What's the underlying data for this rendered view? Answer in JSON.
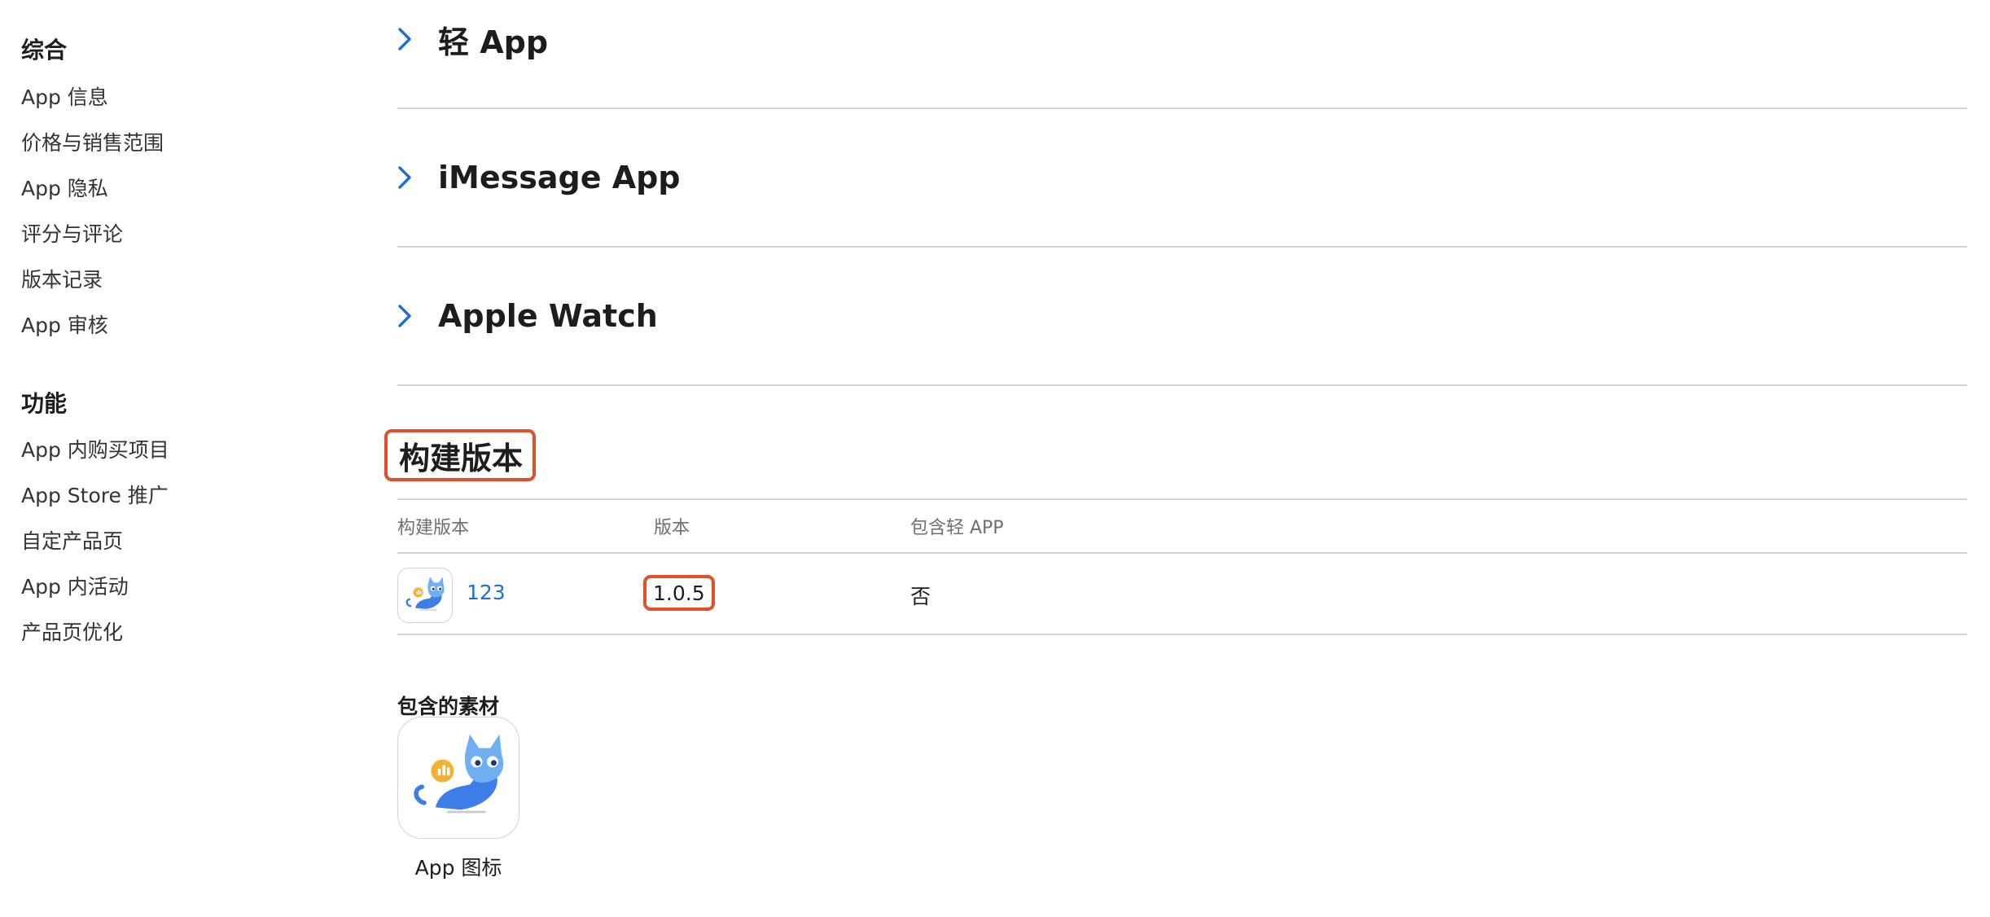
{
  "sidebar": {
    "general": {
      "title": "综合",
      "items": [
        "App 信息",
        "价格与销售范围",
        "App 隐私",
        "评分与评论",
        "版本记录",
        "App 审核"
      ]
    },
    "features": {
      "title": "功能",
      "items": [
        "App 内购买项目",
        "App Store 推广",
        "自定产品页",
        "App 内活动",
        "产品页优化"
      ]
    }
  },
  "main": {
    "sections": [
      {
        "label": "轻 App",
        "icon": "chevron-right-icon"
      },
      {
        "label": "iMessage App",
        "icon": "chevron-right-icon"
      },
      {
        "label": "Apple Watch",
        "icon": "chevron-right-icon"
      }
    ],
    "builds": {
      "heading": "构建版本",
      "columns": [
        "构建版本",
        "版本",
        "包含轻 APP"
      ],
      "row": {
        "icon": "app-cat-icon",
        "build": "123",
        "version": "1.0.5",
        "includes_clip": "否"
      }
    },
    "assets": {
      "title": "包含的素材",
      "icon": "app-cat-icon",
      "caption": "App 图标"
    }
  },
  "colors": {
    "accent": "#1e6fd0",
    "highlight": "#e0512b",
    "divider": "#d2d2d7",
    "muted": "#6e6e73"
  }
}
